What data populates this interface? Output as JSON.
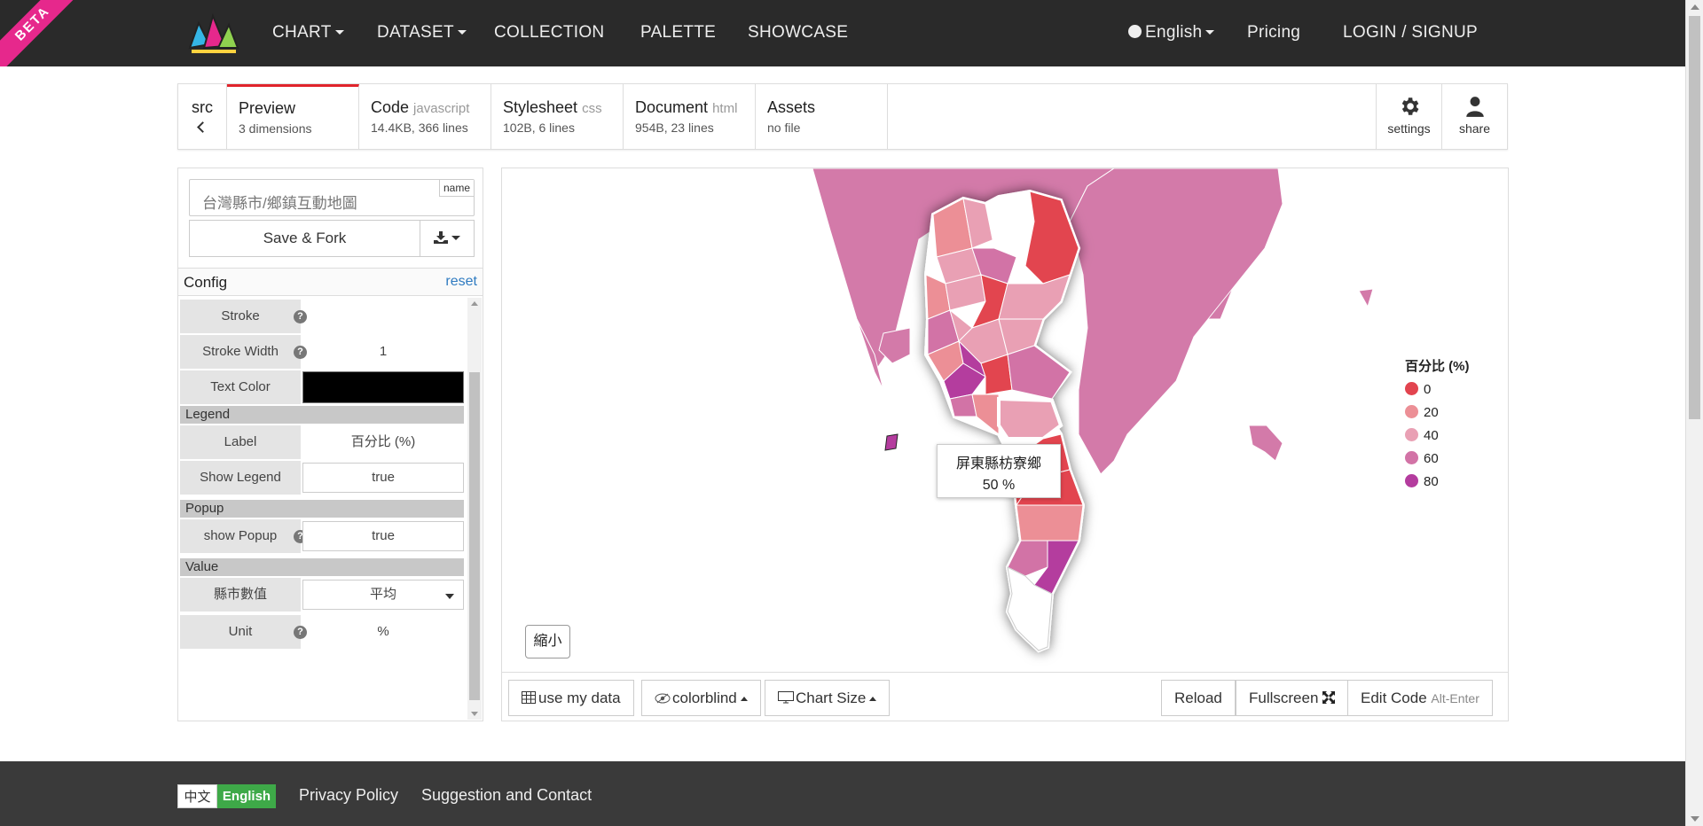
{
  "nav": {
    "beta": "BETA",
    "chart": "CHART",
    "dataset": "DATASET",
    "collection": "COLLECTION",
    "palette": "PALETTE",
    "showcase": "SHOWCASE",
    "language": "English",
    "pricing": "Pricing",
    "login": "LOGIN / SIGNUP"
  },
  "tabs": {
    "src": "src",
    "items": [
      {
        "title": "Preview",
        "sub": "",
        "info": "3 dimensions"
      },
      {
        "title": "Code",
        "sub": "javascript",
        "info": "14.4KB, 366 lines"
      },
      {
        "title": "Stylesheet",
        "sub": "css",
        "info": "102B, 6 lines"
      },
      {
        "title": "Document",
        "sub": "html",
        "info": "954B, 23 lines"
      },
      {
        "title": "Assets",
        "sub": "",
        "info": "no file"
      }
    ],
    "settings": "settings",
    "share": "share"
  },
  "panel": {
    "name_placeholder": "台灣縣市/鄉鎮互動地圖",
    "name_badge": "name",
    "save": "Save & Fork",
    "config": "Config",
    "reset": "reset",
    "stroke": "Stroke",
    "stroke_width": "Stroke Width",
    "stroke_width_value": "1",
    "text_color": "Text Color",
    "text_color_value": "#000000",
    "legend_section": "Legend",
    "legend_label": "Label",
    "legend_label_value": "百分比 (%)",
    "show_legend": "Show Legend",
    "show_legend_value": "true",
    "popup_section": "Popup",
    "show_popup": "show Popup",
    "show_popup_value": "true",
    "value_section": "Value",
    "county_value": "縣市數值",
    "county_value_value": "平均",
    "unit": "Unit",
    "unit_value": "%"
  },
  "chart": {
    "tooltip_name": "屏東縣枋寮鄉",
    "tooltip_value": "50 %",
    "zoom": "縮小",
    "legend_title": "百分比 (%)",
    "legend_items": [
      {
        "label": "0",
        "color": "#e2444f"
      },
      {
        "label": "20",
        "color": "#ec8f96"
      },
      {
        "label": "40",
        "color": "#e9a0b4"
      },
      {
        "label": "60",
        "color": "#d273a6"
      },
      {
        "label": "80",
        "color": "#b43c9e"
      }
    ],
    "region_fill": "#d37aa9",
    "use_my_data": "use my data",
    "colorblind": "colorblind",
    "chart_size": "Chart Size",
    "reload": "Reload",
    "fullscreen": "Fullscreen",
    "edit_code": "Edit Code",
    "edit_code_hint": "Alt-Enter"
  },
  "footer": {
    "zh": "中文",
    "en": "English",
    "privacy": "Privacy Policy",
    "contact": "Suggestion and Contact"
  }
}
